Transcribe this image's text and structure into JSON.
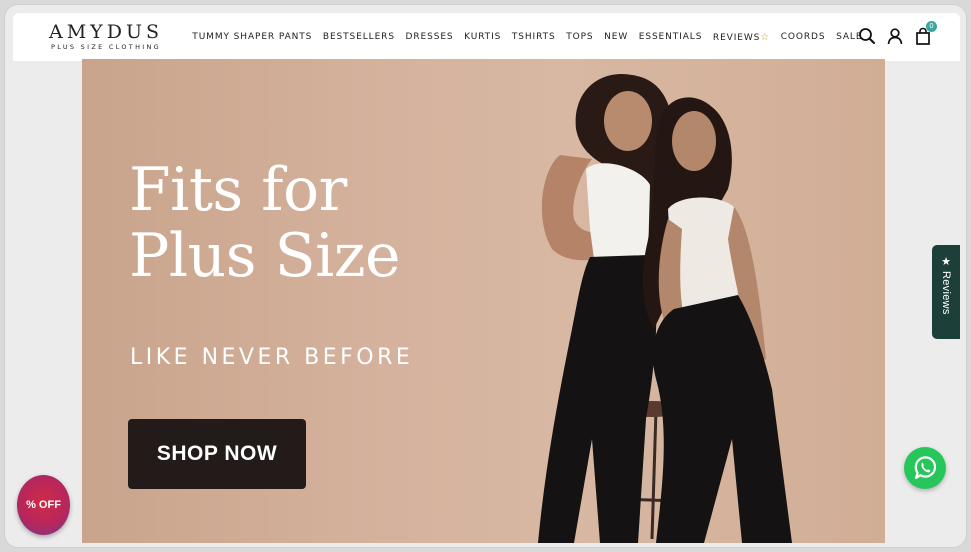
{
  "brand": {
    "name": "AMYDUS",
    "tagline": "PLUS SIZE CLOTHING"
  },
  "nav": {
    "items": [
      {
        "label": "TUMMY SHAPER PANTS"
      },
      {
        "label": "BESTSELLERS"
      },
      {
        "label": "DRESSES"
      },
      {
        "label": "KURTIS"
      },
      {
        "label": "TSHIRTS"
      },
      {
        "label": "TOPS"
      },
      {
        "label": "NEW"
      },
      {
        "label": "ESSENTIALS"
      },
      {
        "label": "REVIEWS",
        "icon": "star-icon"
      },
      {
        "label": "COORDS"
      },
      {
        "label": "SALE"
      }
    ]
  },
  "header_icons": {
    "search": "search-icon",
    "account": "user-icon",
    "cart": "shopping-bag-icon",
    "cart_count": "0"
  },
  "hero": {
    "title_line1": "Fits for",
    "title_line2": "Plus Size",
    "subtitle": "LIKE NEVER BEFORE",
    "cta_label": "SHOP NOW"
  },
  "widgets": {
    "reviews_tab_label": "Reviews",
    "discount_badge": "% OFF",
    "whatsapp_icon": "whatsapp-icon"
  },
  "colors": {
    "hero_bg": "#d4b19c",
    "cta_bg": "#231b19",
    "reviews_tab_bg": "#1c3f39",
    "whatsapp": "#27c65a",
    "cart_badge": "#3aa5a0"
  }
}
